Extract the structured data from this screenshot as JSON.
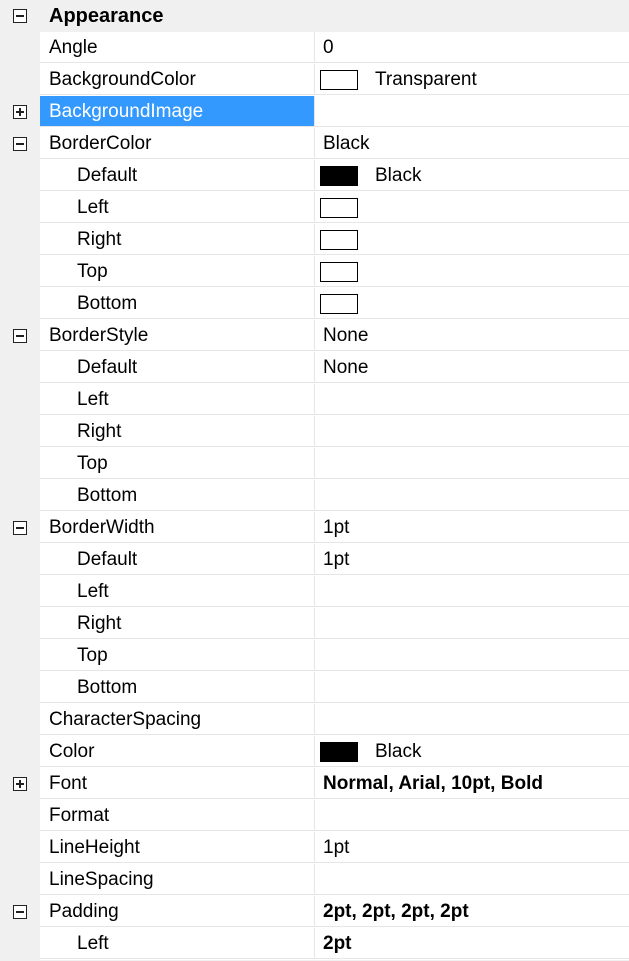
{
  "category": {
    "label": "Appearance",
    "expanded": true
  },
  "rows": [
    {
      "name": "Angle",
      "value": "0"
    },
    {
      "name": "BackgroundColor",
      "value": "Transparent",
      "swatch": "#ffffff"
    },
    {
      "name": "BackgroundImage",
      "value": "",
      "expander": "plus",
      "selected": true
    },
    {
      "name": "BorderColor",
      "value": "Black",
      "expander": "minus"
    },
    {
      "name": "Default",
      "value": "Black",
      "swatch": "#000000",
      "indent": true
    },
    {
      "name": "Left",
      "value": "",
      "swatch": "#ffffff",
      "indent": true
    },
    {
      "name": "Right",
      "value": "",
      "swatch": "#ffffff",
      "indent": true
    },
    {
      "name": "Top",
      "value": "",
      "swatch": "#ffffff",
      "indent": true
    },
    {
      "name": "Bottom",
      "value": "",
      "swatch": "#ffffff",
      "indent": true
    },
    {
      "name": "BorderStyle",
      "value": "None",
      "expander": "minus"
    },
    {
      "name": "Default",
      "value": "None",
      "indent": true
    },
    {
      "name": "Left",
      "value": "",
      "indent": true
    },
    {
      "name": "Right",
      "value": "",
      "indent": true
    },
    {
      "name": "Top",
      "value": "",
      "indent": true
    },
    {
      "name": "Bottom",
      "value": "",
      "indent": true
    },
    {
      "name": "BorderWidth",
      "value": "1pt",
      "expander": "minus"
    },
    {
      "name": "Default",
      "value": "1pt",
      "indent": true
    },
    {
      "name": "Left",
      "value": "",
      "indent": true
    },
    {
      "name": "Right",
      "value": "",
      "indent": true
    },
    {
      "name": "Top",
      "value": "",
      "indent": true
    },
    {
      "name": "Bottom",
      "value": "",
      "indent": true
    },
    {
      "name": "CharacterSpacing",
      "value": ""
    },
    {
      "name": "Color",
      "value": "Black",
      "swatch": "#000000"
    },
    {
      "name": "Font",
      "value": "Normal, Arial, 10pt, Bold",
      "expander": "plus",
      "bold": true
    },
    {
      "name": "Format",
      "value": ""
    },
    {
      "name": "LineHeight",
      "value": "1pt"
    },
    {
      "name": "LineSpacing",
      "value": ""
    },
    {
      "name": "Padding",
      "value": "2pt, 2pt, 2pt, 2pt",
      "expander": "minus",
      "bold": true
    },
    {
      "name": "Left",
      "value": "2pt",
      "indent": true,
      "bold": true
    }
  ],
  "colors": {
    "selection": "#3399ff",
    "gutter": "#f0f0f0",
    "gridline": "#e6e6e6"
  }
}
